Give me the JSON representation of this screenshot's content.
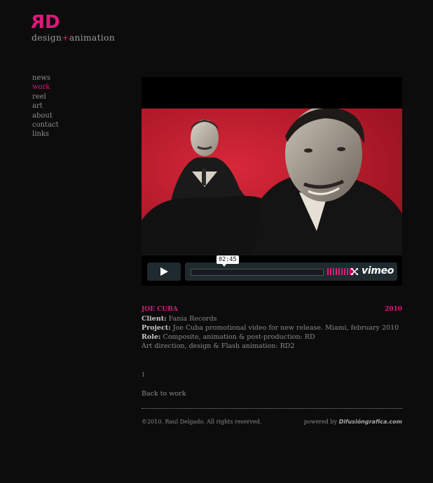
{
  "logo": {
    "mark": "RD",
    "text_design": "design",
    "text_plus": "+",
    "text_animation": "animation"
  },
  "nav": {
    "items": [
      {
        "label": "news"
      },
      {
        "label": "work",
        "active": true
      },
      {
        "label": "reel"
      },
      {
        "label": "art"
      },
      {
        "label": "about"
      },
      {
        "label": "contact"
      },
      {
        "label": "links"
      }
    ]
  },
  "player": {
    "time": "02:45",
    "brand": "vimeo",
    "volume_bars": 10,
    "play_icon": "play-icon",
    "fullscreen_icon": "fullscreen-icon"
  },
  "project": {
    "title": "JOE CUBA",
    "year": "2010",
    "client_label": "Client:",
    "client_value": "Fania Records",
    "project_label": "Project:",
    "project_value": "Joe Cuba promotional video for new release. Miami, february 2010",
    "role_label": "Role:",
    "role_value": "Composite, animation & post-production: RD",
    "credits": "Art direction, design & Flash animation: RD2"
  },
  "pager": {
    "current": "1"
  },
  "back_link": "Back to work",
  "footer": {
    "copyright": "©2010. Raul Delgado. All rights reserved.",
    "powered_by": "powered by",
    "brand": "Difusióngrafica.com"
  },
  "colors": {
    "accent": "#e0177b",
    "background": "#0c0c0c",
    "video_background": "#c41a2a"
  }
}
